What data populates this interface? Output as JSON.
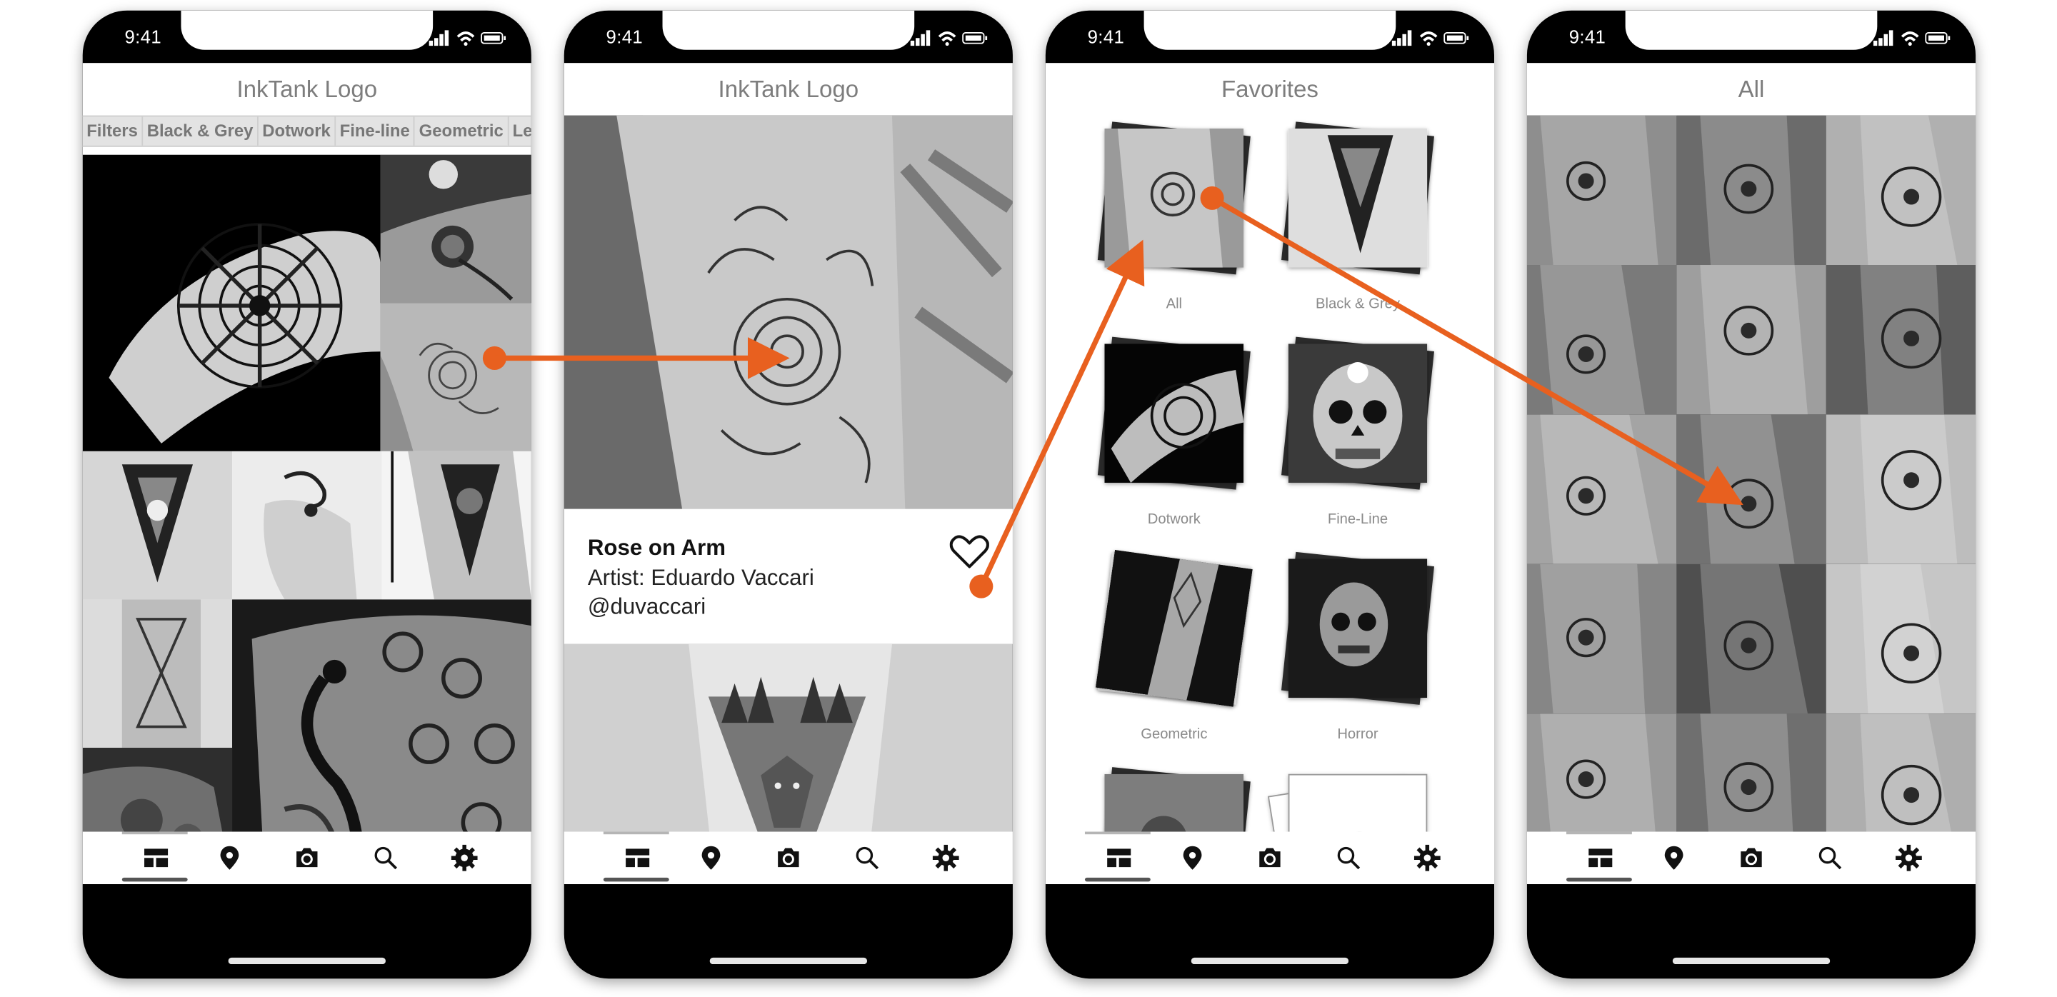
{
  "status_time": "9:41",
  "screens": {
    "feed": {
      "title": "InkTank Logo",
      "filters": [
        "Filters",
        "Black & Grey",
        "Dotwork",
        "Fine-line",
        "Geometric",
        "Lette"
      ]
    },
    "detail": {
      "title": "InkTank Logo",
      "name": "Rose on Arm",
      "artist": "Artist: Eduardo Vaccari",
      "handle": "@duvaccari"
    },
    "favorites": {
      "title": "Favorites",
      "collections": [
        "All",
        "Black & Grey",
        "Dotwork",
        "Fine-Line",
        "Geometric",
        "Horror"
      ],
      "add_label": "+"
    },
    "all": {
      "title": "All"
    }
  },
  "tabbar_icons": [
    "feed-grid-icon",
    "location-pin-icon",
    "camera-icon",
    "search-icon",
    "settings-gear-icon"
  ],
  "colors": {
    "accent": "#e8601f",
    "navbar_text": "#7d7d7d",
    "filter_bar": "#e3e3e3"
  }
}
